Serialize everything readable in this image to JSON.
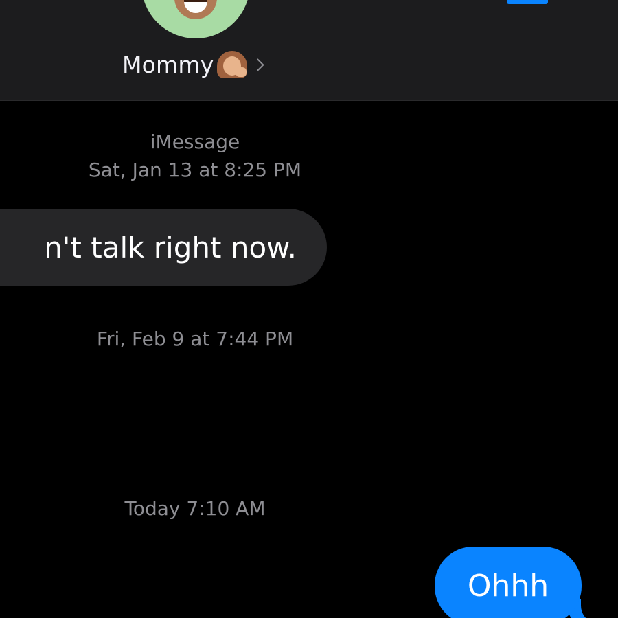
{
  "header": {
    "contact_name": "Mommy",
    "contact_emoji_icon": "woman-with-hand-on-cheek-emoji",
    "chevron_icon": "chevron-right-icon",
    "avatar_icon": "memoji-avatar",
    "video_icon": "facetime-video-icon"
  },
  "conversation": {
    "service": "iMessage",
    "messages": [
      {
        "timestamp": "Sat, Jan 13 at 8:25 PM",
        "direction": "incoming",
        "text": "n't talk right now."
      },
      {
        "timestamp": "Fri, Feb 9 at 7:44 PM"
      },
      {
        "timestamp": "Today 7:10 AM",
        "direction": "outgoing",
        "text": "Ohhh"
      }
    ]
  },
  "colors": {
    "background": "#000000",
    "header_background": "#1c1c1e",
    "incoming_bubble": "#262628",
    "outgoing_bubble": "#0a84ff",
    "secondary_text": "#8e8e93",
    "avatar_background": "#a8dba4"
  }
}
